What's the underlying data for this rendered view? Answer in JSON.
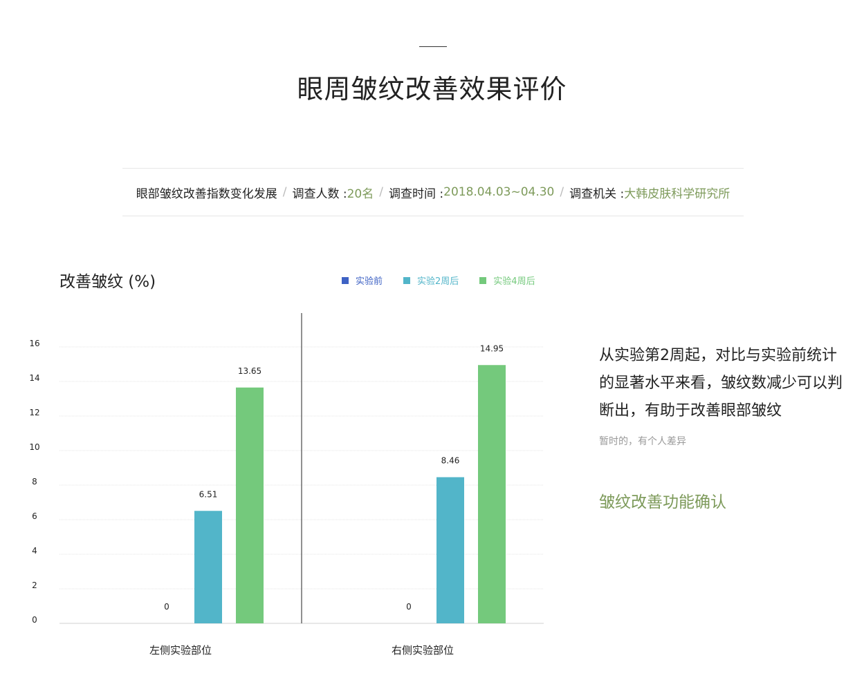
{
  "page": {
    "title": "眼周皱纹改善效果评价"
  },
  "info": {
    "topic": "眼部皱纹改善指数变化发展",
    "people_label": "调查人数 : ",
    "people_value": "20名",
    "time_label": "调查时间 : ",
    "time_value": "2018.04.03~04.30",
    "org_label": "调查机关 : ",
    "org_value": "大韩皮肤科学研究所",
    "separator": "/"
  },
  "side": {
    "description": "从实验第2周起，对比与实验前统计的显著水平来看，皱纹数减少可以判断出，有助于改善眼部皱纹",
    "note": "暂时的，有个人差异",
    "confirm": "皱纹改善功能确认"
  },
  "chart_data": {
    "type": "bar",
    "title": "改善皱纹 (%)",
    "categories": [
      "左侧实验部位",
      "右侧实验部位"
    ],
    "series": [
      {
        "name": "实验前",
        "color": "#3e62c4",
        "values": [
          0,
          0
        ]
      },
      {
        "name": "实验2周后",
        "color": "#52b5c9",
        "values": [
          6.51,
          8.46
        ]
      },
      {
        "name": "实验4周后",
        "color": "#74c97c",
        "values": [
          13.65,
          14.95
        ]
      }
    ],
    "y_ticks": [
      "0",
      "2",
      "4",
      "6",
      "8",
      "10",
      "12",
      "14",
      "16"
    ],
    "ylim": [
      0,
      16
    ],
    "grid": true,
    "legend_position": "top"
  }
}
